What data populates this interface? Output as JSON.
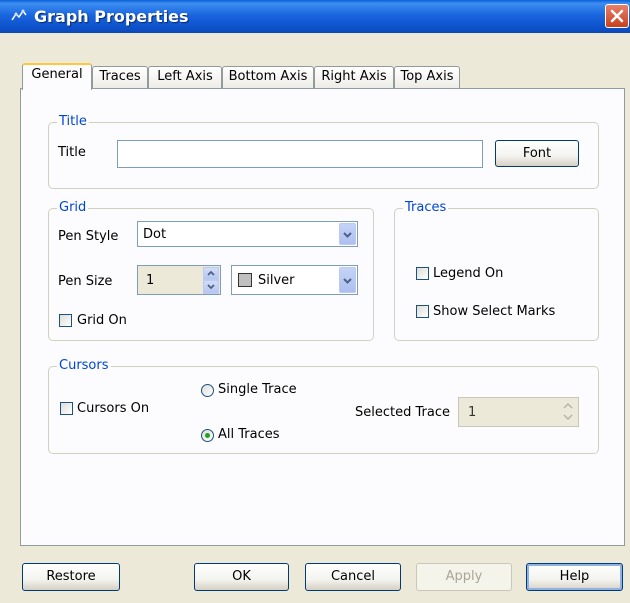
{
  "window": {
    "title": "Graph Properties"
  },
  "tabs": [
    {
      "label": "General"
    },
    {
      "label": "Traces"
    },
    {
      "label": "Left Axis"
    },
    {
      "label": "Bottom Axis"
    },
    {
      "label": "Right Axis"
    },
    {
      "label": "Top Axis"
    }
  ],
  "title_group": {
    "legend": "Title",
    "title_label": "Title",
    "title_value": "",
    "font_button": "Font"
  },
  "grid_group": {
    "legend": "Grid",
    "pen_style_label": "Pen Style",
    "pen_style_value": "Dot",
    "pen_size_label": "Pen Size",
    "pen_size_value": "1",
    "color_value": "Silver",
    "color_swatch": "#c0c0c0",
    "grid_on_label": "Grid On",
    "grid_on_checked": false
  },
  "traces_group": {
    "legend": "Traces",
    "legend_on_label": "Legend On",
    "legend_on_checked": false,
    "show_select_marks_label": "Show Select Marks",
    "show_select_marks_checked": false
  },
  "cursors_group": {
    "legend": "Cursors",
    "cursors_on_label": "Cursors On",
    "cursors_on_checked": false,
    "single_trace_label": "Single Trace",
    "all_traces_label": "All Traces",
    "selected_mode": "All Traces",
    "selected_trace_label": "Selected Trace",
    "selected_trace_value": "1"
  },
  "buttons": {
    "restore": "Restore",
    "ok": "OK",
    "cancel": "Cancel",
    "apply": "Apply",
    "help": "Help"
  },
  "colors": {
    "titlebar": "#0a5fd8",
    "group_label": "#0046d5",
    "dialog_bg": "#ece9d8"
  }
}
